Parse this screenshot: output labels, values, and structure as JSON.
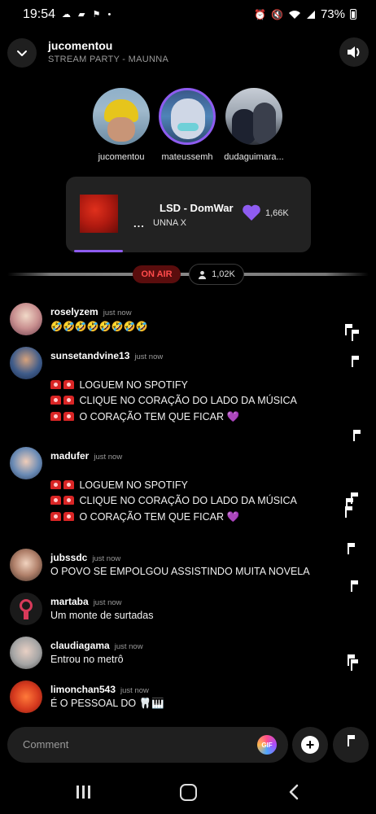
{
  "status_bar": {
    "time": "19:54",
    "left_icons": "☁ ▰ ⚑ •",
    "battery": "73%"
  },
  "header": {
    "title": "jucomentou",
    "subtitle": "STREAM PARTY - MAUNNA"
  },
  "participants": [
    {
      "name": "jucomentou",
      "active": false
    },
    {
      "name": "mateussemh",
      "active": true
    },
    {
      "name": "dudaguimara...",
      "active": false
    }
  ],
  "now_playing": {
    "dots": "...",
    "title": "LSD - DomWar",
    "artist": "UNNA X",
    "likes": "1,66K",
    "progress": 0.2
  },
  "live": {
    "on_air_label": "ON AIR",
    "listeners": "1,02K"
  },
  "comments": [
    {
      "user": "roselyzem",
      "time": "just now",
      "lines": [
        "🤣🤣🤣🤣🤣🤣🤣🤣"
      ]
    },
    {
      "user": "sunsetandvine13",
      "time": "just now",
      "lines": [
        "LOGUEM NO SPOTIFY",
        "CLIQUE NO CORAÇÃO DO LADO DA MÚSICA",
        "O CORAÇÃO TEM QUE FICAR"
      ]
    },
    {
      "user": "madufer",
      "time": "just now",
      "lines": [
        "LOGUEM NO SPOTIFY",
        "CLIQUE NO CORAÇÃO DO LADO DA MÚSICA",
        "O CORAÇÃO TEM QUE FICAR"
      ]
    },
    {
      "user": "jubssdc",
      "time": "just now",
      "lines": [
        "O POVO SE EMPOLGOU ASSISTINDO MUITA NOVELA"
      ]
    },
    {
      "user": "martaba",
      "time": "just now",
      "lines": [
        "Um monte de surtadas"
      ]
    },
    {
      "user": "claudiagama",
      "time": "just now",
      "lines": [
        "Entrou no metrô"
      ]
    },
    {
      "user": "limonchan543",
      "time": "just now",
      "lines": [
        "É O PESSOAL DO 🦷🎹"
      ]
    }
  ],
  "composer": {
    "placeholder": "Comment",
    "gif_label": "GIF"
  },
  "colors": {
    "accent": "#8e5cf0",
    "on_air_bg": "#5a0d0d",
    "on_air_text": "#ff4b4b",
    "surface": "#222222"
  }
}
